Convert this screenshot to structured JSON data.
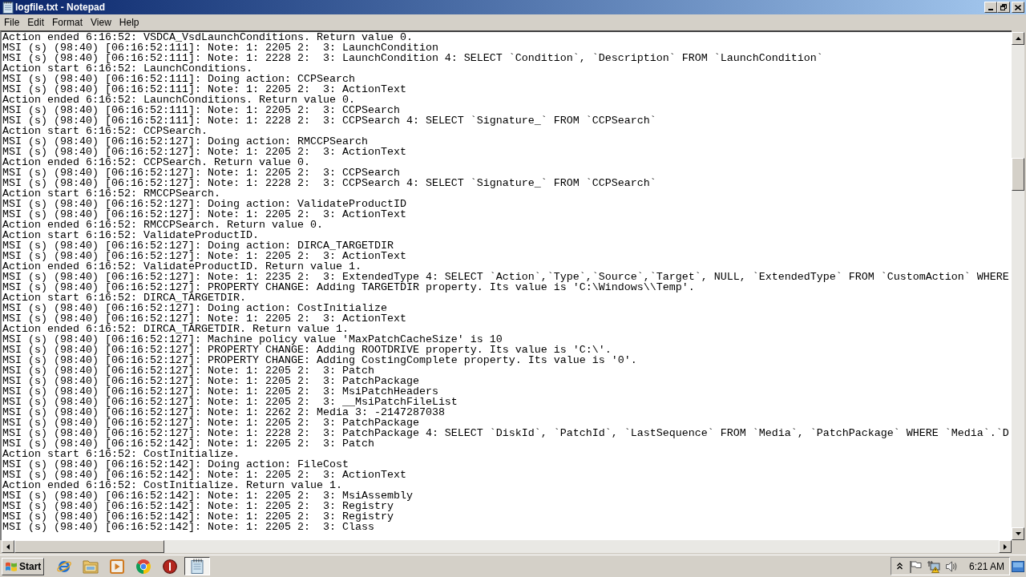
{
  "window": {
    "title": "logfile.txt - Notepad"
  },
  "menu": [
    "File",
    "Edit",
    "Format",
    "View",
    "Help"
  ],
  "document": {
    "lines": [
      "Action ended 6:16:52: VSDCA_VsdLaunchConditions. Return value 0.",
      "MSI (s) (98:40) [06:16:52:111]: Note: 1: 2205 2:  3: LaunchCondition",
      "MSI (s) (98:40) [06:16:52:111]: Note: 1: 2228 2:  3: LaunchCondition 4: SELECT `Condition`, `Description` FROM `LaunchCondition`",
      "Action start 6:16:52: LaunchConditions.",
      "MSI (s) (98:40) [06:16:52:111]: Doing action: CCPSearch",
      "MSI (s) (98:40) [06:16:52:111]: Note: 1: 2205 2:  3: ActionText",
      "Action ended 6:16:52: LaunchConditions. Return value 0.",
      "MSI (s) (98:40) [06:16:52:111]: Note: 1: 2205 2:  3: CCPSearch",
      "MSI (s) (98:40) [06:16:52:111]: Note: 1: 2228 2:  3: CCPSearch 4: SELECT `Signature_` FROM `CCPSearch`",
      "Action start 6:16:52: CCPSearch.",
      "MSI (s) (98:40) [06:16:52:127]: Doing action: RMCCPSearch",
      "MSI (s) (98:40) [06:16:52:127]: Note: 1: 2205 2:  3: ActionText",
      "Action ended 6:16:52: CCPSearch. Return value 0.",
      "MSI (s) (98:40) [06:16:52:127]: Note: 1: 2205 2:  3: CCPSearch",
      "MSI (s) (98:40) [06:16:52:127]: Note: 1: 2228 2:  3: CCPSearch 4: SELECT `Signature_` FROM `CCPSearch`",
      "Action start 6:16:52: RMCCPSearch.",
      "MSI (s) (98:40) [06:16:52:127]: Doing action: ValidateProductID",
      "MSI (s) (98:40) [06:16:52:127]: Note: 1: 2205 2:  3: ActionText",
      "Action ended 6:16:52: RMCCPSearch. Return value 0.",
      "Action start 6:16:52: ValidateProductID.",
      "MSI (s) (98:40) [06:16:52:127]: Doing action: DIRCA_TARGETDIR",
      "MSI (s) (98:40) [06:16:52:127]: Note: 1: 2205 2:  3: ActionText",
      "Action ended 6:16:52: ValidateProductID. Return value 1.",
      "MSI (s) (98:40) [06:16:52:127]: Note: 1: 2235 2:  3: ExtendedType 4: SELECT `Action`,`Type`,`Source`,`Target`, NULL, `ExtendedType` FROM `CustomAction` WHERE",
      "MSI (s) (98:40) [06:16:52:127]: PROPERTY CHANGE: Adding TARGETDIR property. Its value is 'C:\\Windows\\\\Temp'.",
      "Action start 6:16:52: DIRCA_TARGETDIR.",
      "MSI (s) (98:40) [06:16:52:127]: Doing action: CostInitialize",
      "MSI (s) (98:40) [06:16:52:127]: Note: 1: 2205 2:  3: ActionText",
      "Action ended 6:16:52: DIRCA_TARGETDIR. Return value 1.",
      "MSI (s) (98:40) [06:16:52:127]: Machine policy value 'MaxPatchCacheSize' is 10",
      "MSI (s) (98:40) [06:16:52:127]: PROPERTY CHANGE: Adding ROOTDRIVE property. Its value is 'C:\\'.",
      "MSI (s) (98:40) [06:16:52:127]: PROPERTY CHANGE: Adding CostingComplete property. Its value is '0'.",
      "MSI (s) (98:40) [06:16:52:127]: Note: 1: 2205 2:  3: Patch",
      "MSI (s) (98:40) [06:16:52:127]: Note: 1: 2205 2:  3: PatchPackage",
      "MSI (s) (98:40) [06:16:52:127]: Note: 1: 2205 2:  3: MsiPatchHeaders",
      "MSI (s) (98:40) [06:16:52:127]: Note: 1: 2205 2:  3: __MsiPatchFileList",
      "MSI (s) (98:40) [06:16:52:127]: Note: 1: 2262 2: Media 3: -2147287038",
      "MSI (s) (98:40) [06:16:52:127]: Note: 1: 2205 2:  3: PatchPackage",
      "MSI (s) (98:40) [06:16:52:127]: Note: 1: 2228 2:  3: PatchPackage 4: SELECT `DiskId`, `PatchId`, `LastSequence` FROM `Media`, `PatchPackage` WHERE `Media`.`D",
      "MSI (s) (98:40) [06:16:52:142]: Note: 1: 2205 2:  3: Patch",
      "Action start 6:16:52: CostInitialize.",
      "MSI (s) (98:40) [06:16:52:142]: Doing action: FileCost",
      "MSI (s) (98:40) [06:16:52:142]: Note: 1: 2205 2:  3: ActionText",
      "Action ended 6:16:52: CostInitialize. Return value 1.",
      "MSI (s) (98:40) [06:16:52:142]: Note: 1: 2205 2:  3: MsiAssembly",
      "MSI (s) (98:40) [06:16:52:142]: Note: 1: 2205 2:  3: Registry",
      "MSI (s) (98:40) [06:16:52:142]: Note: 1: 2205 2:  3: Registry",
      "MSI (s) (98:40) [06:16:52:142]: Note: 1: 2205 2:  3: Class"
    ]
  },
  "taskbar": {
    "start_label": "Start",
    "apps": [
      {
        "kind": "ring",
        "selected": false
      },
      {
        "kind": "folder",
        "selected": false
      },
      {
        "kind": "player",
        "selected": false
      },
      {
        "kind": "wheel",
        "selected": false
      },
      {
        "kind": "stop",
        "selected": false
      },
      {
        "kind": "notepad",
        "selected": true
      }
    ],
    "clock": "6:21 AM"
  }
}
